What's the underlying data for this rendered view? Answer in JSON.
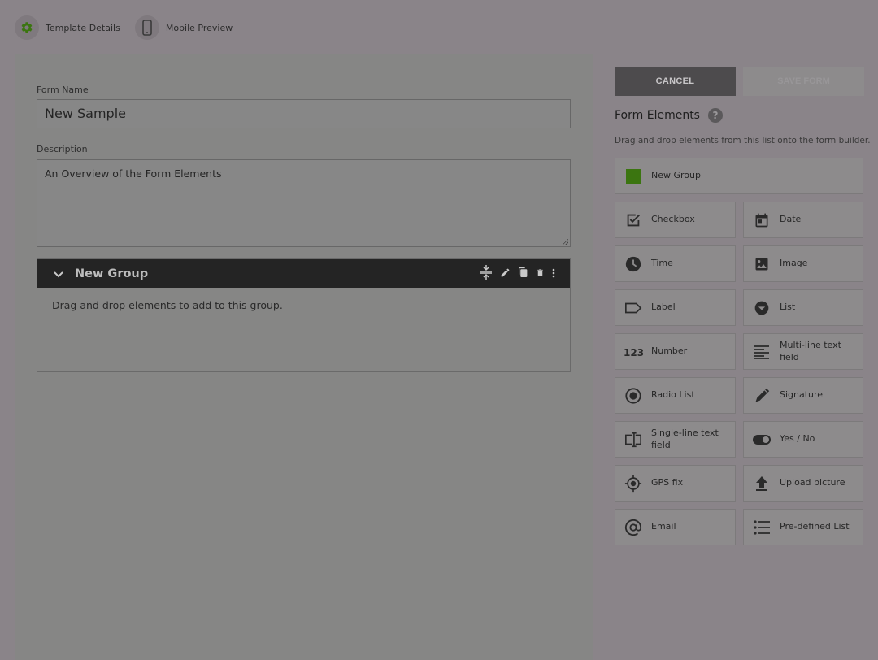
{
  "tabs": [
    {
      "label": "Template Details",
      "icon": "gear-icon"
    },
    {
      "label": "Mobile Preview",
      "icon": "phone-icon"
    }
  ],
  "form": {
    "name_label": "Form Name",
    "name_value": "New Sample",
    "description_label": "Description",
    "description_value": "An Overview of the Form Elements"
  },
  "group": {
    "title": "New Group",
    "placeholder": "Drag and drop elements to add to this group."
  },
  "actions": {
    "cancel": "CANCEL",
    "save": "SAVE FORM"
  },
  "elements_panel": {
    "title": "Form Elements",
    "help": "?",
    "hint": "Drag and drop elements from this list onto the form builder.",
    "new_group": "New Group",
    "items": [
      {
        "label": "Checkbox",
        "icon": "checkbox-icon"
      },
      {
        "label": "Date",
        "icon": "calendar-icon"
      },
      {
        "label": "Time",
        "icon": "clock-icon"
      },
      {
        "label": "Image",
        "icon": "image-icon"
      },
      {
        "label": "Label",
        "icon": "label-icon"
      },
      {
        "label": "List",
        "icon": "dropdown-icon"
      },
      {
        "label": "Number",
        "icon": "number-icon"
      },
      {
        "label": "Multi-line text field",
        "icon": "multiline-icon"
      },
      {
        "label": "Radio List",
        "icon": "radio-icon"
      },
      {
        "label": "Signature",
        "icon": "pen-icon"
      },
      {
        "label": "Single-line text field",
        "icon": "text-cursor-icon"
      },
      {
        "label": "Yes / No",
        "icon": "toggle-icon"
      },
      {
        "label": "GPS fix",
        "icon": "gps-icon"
      },
      {
        "label": "Upload picture",
        "icon": "upload-icon"
      },
      {
        "label": "Email",
        "icon": "at-icon"
      },
      {
        "label": "Pre-defined List",
        "icon": "list-icon"
      }
    ]
  },
  "colors": {
    "accent_green": "#3b7510",
    "overlay": "#8a8489"
  }
}
